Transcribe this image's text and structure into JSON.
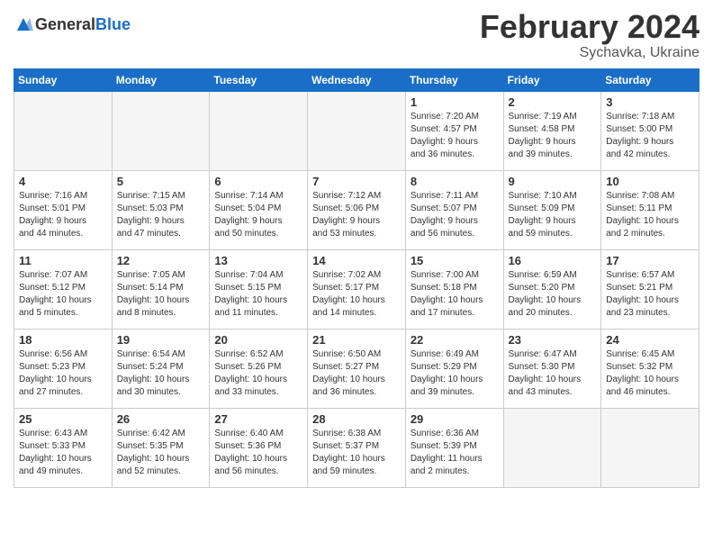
{
  "logo": {
    "text_general": "General",
    "text_blue": "Blue"
  },
  "title": "February 2024",
  "subtitle": "Sychavka, Ukraine",
  "days_of_week": [
    "Sunday",
    "Monday",
    "Tuesday",
    "Wednesday",
    "Thursday",
    "Friday",
    "Saturday"
  ],
  "weeks": [
    [
      {
        "day": "",
        "info": ""
      },
      {
        "day": "",
        "info": ""
      },
      {
        "day": "",
        "info": ""
      },
      {
        "day": "",
        "info": ""
      },
      {
        "day": "1",
        "info": "Sunrise: 7:20 AM\nSunset: 4:57 PM\nDaylight: 9 hours\nand 36 minutes."
      },
      {
        "day": "2",
        "info": "Sunrise: 7:19 AM\nSunset: 4:58 PM\nDaylight: 9 hours\nand 39 minutes."
      },
      {
        "day": "3",
        "info": "Sunrise: 7:18 AM\nSunset: 5:00 PM\nDaylight: 9 hours\nand 42 minutes."
      }
    ],
    [
      {
        "day": "4",
        "info": "Sunrise: 7:16 AM\nSunset: 5:01 PM\nDaylight: 9 hours\nand 44 minutes."
      },
      {
        "day": "5",
        "info": "Sunrise: 7:15 AM\nSunset: 5:03 PM\nDaylight: 9 hours\nand 47 minutes."
      },
      {
        "day": "6",
        "info": "Sunrise: 7:14 AM\nSunset: 5:04 PM\nDaylight: 9 hours\nand 50 minutes."
      },
      {
        "day": "7",
        "info": "Sunrise: 7:12 AM\nSunset: 5:06 PM\nDaylight: 9 hours\nand 53 minutes."
      },
      {
        "day": "8",
        "info": "Sunrise: 7:11 AM\nSunset: 5:07 PM\nDaylight: 9 hours\nand 56 minutes."
      },
      {
        "day": "9",
        "info": "Sunrise: 7:10 AM\nSunset: 5:09 PM\nDaylight: 9 hours\nand 59 minutes."
      },
      {
        "day": "10",
        "info": "Sunrise: 7:08 AM\nSunset: 5:11 PM\nDaylight: 10 hours\nand 2 minutes."
      }
    ],
    [
      {
        "day": "11",
        "info": "Sunrise: 7:07 AM\nSunset: 5:12 PM\nDaylight: 10 hours\nand 5 minutes."
      },
      {
        "day": "12",
        "info": "Sunrise: 7:05 AM\nSunset: 5:14 PM\nDaylight: 10 hours\nand 8 minutes."
      },
      {
        "day": "13",
        "info": "Sunrise: 7:04 AM\nSunset: 5:15 PM\nDaylight: 10 hours\nand 11 minutes."
      },
      {
        "day": "14",
        "info": "Sunrise: 7:02 AM\nSunset: 5:17 PM\nDaylight: 10 hours\nand 14 minutes."
      },
      {
        "day": "15",
        "info": "Sunrise: 7:00 AM\nSunset: 5:18 PM\nDaylight: 10 hours\nand 17 minutes."
      },
      {
        "day": "16",
        "info": "Sunrise: 6:59 AM\nSunset: 5:20 PM\nDaylight: 10 hours\nand 20 minutes."
      },
      {
        "day": "17",
        "info": "Sunrise: 6:57 AM\nSunset: 5:21 PM\nDaylight: 10 hours\nand 23 minutes."
      }
    ],
    [
      {
        "day": "18",
        "info": "Sunrise: 6:56 AM\nSunset: 5:23 PM\nDaylight: 10 hours\nand 27 minutes."
      },
      {
        "day": "19",
        "info": "Sunrise: 6:54 AM\nSunset: 5:24 PM\nDaylight: 10 hours\nand 30 minutes."
      },
      {
        "day": "20",
        "info": "Sunrise: 6:52 AM\nSunset: 5:26 PM\nDaylight: 10 hours\nand 33 minutes."
      },
      {
        "day": "21",
        "info": "Sunrise: 6:50 AM\nSunset: 5:27 PM\nDaylight: 10 hours\nand 36 minutes."
      },
      {
        "day": "22",
        "info": "Sunrise: 6:49 AM\nSunset: 5:29 PM\nDaylight: 10 hours\nand 39 minutes."
      },
      {
        "day": "23",
        "info": "Sunrise: 6:47 AM\nSunset: 5:30 PM\nDaylight: 10 hours\nand 43 minutes."
      },
      {
        "day": "24",
        "info": "Sunrise: 6:45 AM\nSunset: 5:32 PM\nDaylight: 10 hours\nand 46 minutes."
      }
    ],
    [
      {
        "day": "25",
        "info": "Sunrise: 6:43 AM\nSunset: 5:33 PM\nDaylight: 10 hours\nand 49 minutes."
      },
      {
        "day": "26",
        "info": "Sunrise: 6:42 AM\nSunset: 5:35 PM\nDaylight: 10 hours\nand 52 minutes."
      },
      {
        "day": "27",
        "info": "Sunrise: 6:40 AM\nSunset: 5:36 PM\nDaylight: 10 hours\nand 56 minutes."
      },
      {
        "day": "28",
        "info": "Sunrise: 6:38 AM\nSunset: 5:37 PM\nDaylight: 10 hours\nand 59 minutes."
      },
      {
        "day": "29",
        "info": "Sunrise: 6:36 AM\nSunset: 5:39 PM\nDaylight: 11 hours\nand 2 minutes."
      },
      {
        "day": "",
        "info": ""
      },
      {
        "day": "",
        "info": ""
      }
    ]
  ]
}
